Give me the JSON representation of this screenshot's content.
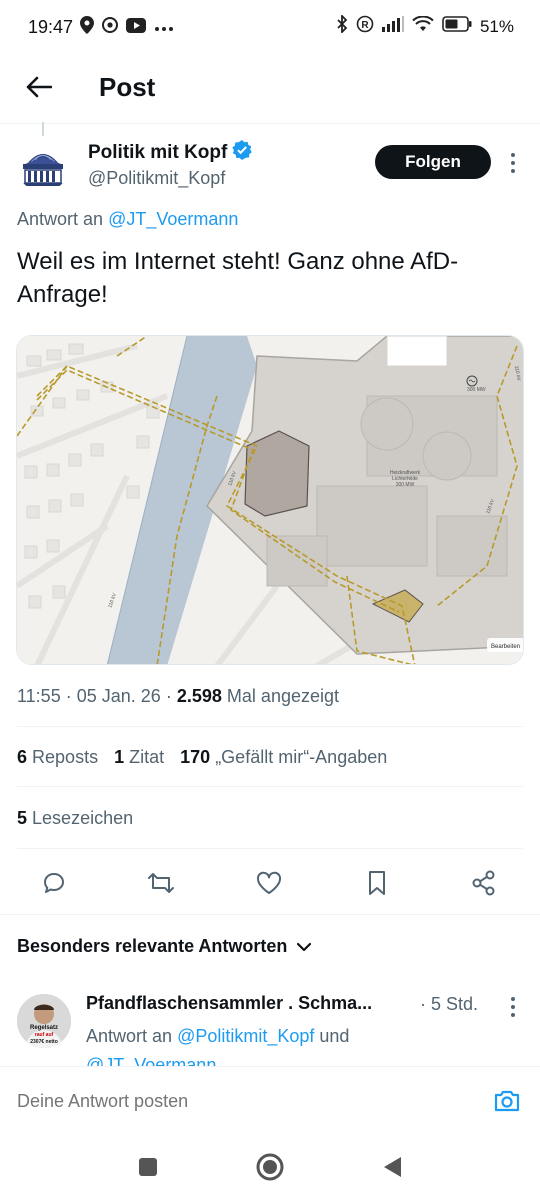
{
  "status_bar": {
    "time": "19:47",
    "battery_text": "51%",
    "icons": [
      "location-icon",
      "chrome-icon",
      "youtube-icon",
      "more-dots-icon",
      "bluetooth-icon",
      "registered-icon",
      "signal-icon",
      "wifi-icon",
      "battery-icon"
    ]
  },
  "header": {
    "title": "Post"
  },
  "post": {
    "author_name": "Politik mit Kopf",
    "author_handle": "@Politikmit_Kopf",
    "follow_label": "Folgen",
    "reply_prefix": "Antwort an",
    "reply_mention": "@JT_Voermann",
    "text": "Weil es im Internet steht! Ganz ohne AfD-Anfrage!",
    "map": {
      "plant_label_line1": "Heizkraftwerk",
      "plant_label_line2": "Lichterfelde",
      "plant_label_line3": "300 MW",
      "power_label": "300 MW",
      "line_label_1": "110 kV",
      "line_label_2": "110 kV",
      "line_label_3": "110 kV",
      "line_label_4": "110 kV",
      "edit_label": "Bearbeiten"
    },
    "time": "11:55",
    "date": "05 Jan. 26",
    "views_count": "2.598",
    "views_label": "Mal angezeigt",
    "sep": "·"
  },
  "stats": {
    "reposts_count": "6",
    "reposts_label": "Reposts",
    "quotes_count": "1",
    "quotes_label": "Zitat",
    "likes_count": "170",
    "likes_label": "„Gefällt mir“-Angaben",
    "bookmarks_count": "5",
    "bookmarks_label": "Lesezeichen"
  },
  "actions": [
    "reply-icon",
    "repost-icon",
    "like-icon",
    "bookmark-icon",
    "share-icon"
  ],
  "replies": {
    "sort_label": "Besonders relevante Antworten",
    "first": {
      "name": "Pfandflaschensammler . Schma...",
      "time": "5 Std.",
      "avatar_text_1": "Regelsatz",
      "avatar_text_2": "rauf auf",
      "avatar_text_3": "2307€ netto",
      "reply_prefix": "Antwort an",
      "mention1": "@Politikmit_Kopf",
      "conj": "und",
      "mention2": "@JT_Voermann"
    }
  },
  "compose": {
    "placeholder": "Deine Antwort posten"
  },
  "colors": {
    "accent": "#1d9bf0",
    "text": "#0f1419",
    "secondary": "#536471"
  }
}
